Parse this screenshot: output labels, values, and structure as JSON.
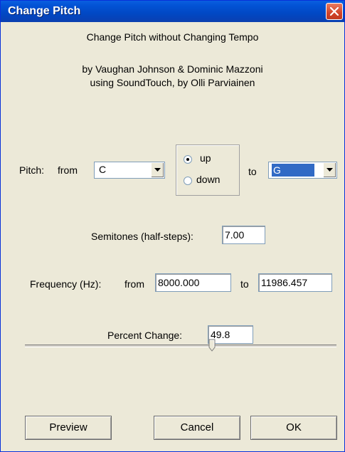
{
  "window": {
    "title": "Change Pitch",
    "close_icon": "close-icon"
  },
  "header": {
    "line1": "Change Pitch without Changing Tempo",
    "line2": "by Vaughan Johnson & Dominic Mazzoni",
    "line3": "using SoundTouch, by Olli Parviainen"
  },
  "pitch": {
    "label": "Pitch:",
    "from_label": "from",
    "from_value": "C",
    "direction": {
      "up_label": "up",
      "down_label": "down",
      "selected": "up"
    },
    "to_label": "to",
    "to_value": "G"
  },
  "semitones": {
    "label": "Semitones (half-steps):",
    "value": "7.00"
  },
  "frequency": {
    "label": "Frequency (Hz):",
    "from_label": "from",
    "from_value": "8000.000",
    "to_label": "to",
    "to_value": "11986.457"
  },
  "percent": {
    "label": "Percent Change:",
    "value": "49.8"
  },
  "slider": {
    "level_fraction": 0.6
  },
  "buttons": {
    "preview": "Preview",
    "cancel": "Cancel",
    "ok": "OK"
  },
  "colors": {
    "title_bar": "#0148c4",
    "close_button": "#d2442a",
    "dialog_bg": "#ece9d8",
    "selection": "#316ac5"
  }
}
